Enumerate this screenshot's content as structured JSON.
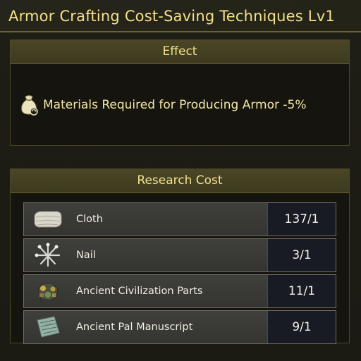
{
  "title": "Armor Crafting Cost-Saving Techniques Lv1",
  "effect": {
    "header": "Effect",
    "icon": "material-bag-icon",
    "text": "Materials Required for Producing Armor -5%"
  },
  "research_cost": {
    "header": "Research Cost",
    "items": [
      {
        "name": "Cloth",
        "count": "137/1",
        "icon": "cloth-icon"
      },
      {
        "name": "Nail",
        "count": "3/1",
        "icon": "nail-icon"
      },
      {
        "name": "Ancient Civilization Parts",
        "count": "11/1",
        "icon": "ancient-parts-icon"
      },
      {
        "name": "Ancient Pal Manuscript",
        "count": "9/1",
        "icon": "manuscript-icon"
      }
    ]
  },
  "colors": {
    "accent": "#f2e28a",
    "panel_header": "#443f22",
    "count_bg": "#191b24"
  }
}
